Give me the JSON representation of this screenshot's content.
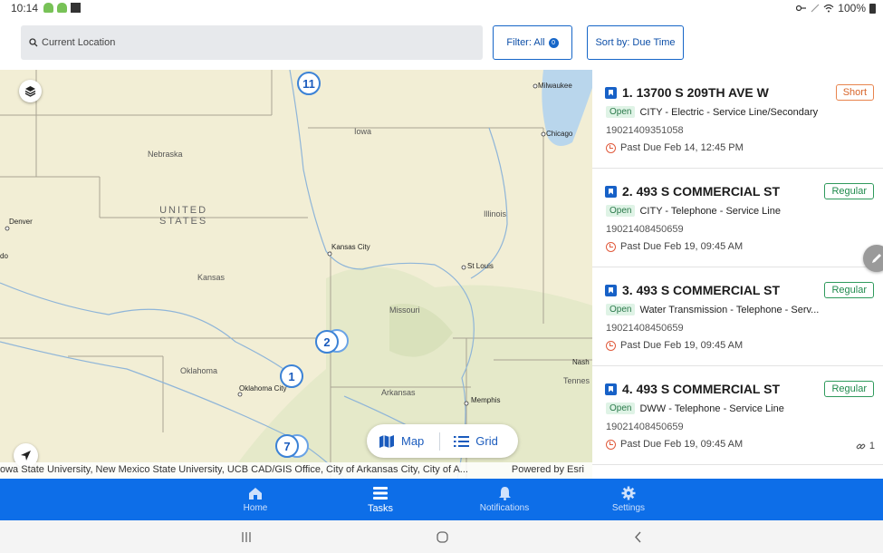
{
  "status_bar": {
    "time": "10:14",
    "battery": "100%"
  },
  "search": {
    "placeholder": "Current Location"
  },
  "filter": {
    "label": "Filter: All",
    "count": "0"
  },
  "sort": {
    "label": "Sort by: Due Time"
  },
  "map": {
    "labels": {
      "nebraska": "Nebraska",
      "iowa": "Iowa",
      "united_states": "UNITED\nSTATES",
      "illinois": "Illinois",
      "kansas": "Kansas",
      "missouri": "Missouri",
      "oklahoma": "Oklahoma",
      "arkansas": "Arkansas",
      "tennessee": "Tennes",
      "denver": "Denver",
      "kansas_city": "Kansas City",
      "st_louis": "St Louis",
      "oklahoma_city": "Oklahoma City",
      "memphis": "Memphis",
      "milwaukee": "Milwaukee",
      "chicago": "Chicago",
      "nashville": "Nash",
      "do": "do"
    },
    "clusters": [
      "11",
      "2",
      "1",
      "7"
    ],
    "toggle": {
      "map": "Map",
      "grid": "Grid"
    },
    "attribution": "owa State University, New Mexico State University, UCB CAD/GIS Office, City of Arkansas City, City of A...",
    "powered_by": "Powered by Esri"
  },
  "tasks": [
    {
      "title": "1. 13700 S 209TH AVE W",
      "type": "Short",
      "status": "Open",
      "description": "CITY - Electric - Service Line/Secondary",
      "number": "19021409351058",
      "due": "Past Due Feb 14, 12:45 PM"
    },
    {
      "title": "2. 493 S COMMERCIAL ST",
      "type": "Regular",
      "status": "Open",
      "description": "CITY - Telephone - Service Line",
      "number": "19021408450659",
      "due": "Past Due Feb 19, 09:45 AM"
    },
    {
      "title": "3. 493 S COMMERCIAL ST",
      "type": "Regular",
      "status": "Open",
      "description": "Water Transmission - Telephone - Serv...",
      "number": "19021408450659",
      "due": "Past Due Feb 19, 09:45 AM"
    },
    {
      "title": "4. 493 S COMMERCIAL ST",
      "type": "Regular",
      "status": "Open",
      "description": "DWW - Telephone - Service Line",
      "number": "19021408450659",
      "due": "Past Due Feb 19, 09:45 AM",
      "links": "1"
    }
  ],
  "nav": {
    "home": "Home",
    "tasks": "Tasks",
    "notifications": "Notifications",
    "settings": "Settings"
  },
  "colors": {
    "primary": "#0d6ee8",
    "short": "#d8652a",
    "regular": "#1f8a4c"
  }
}
